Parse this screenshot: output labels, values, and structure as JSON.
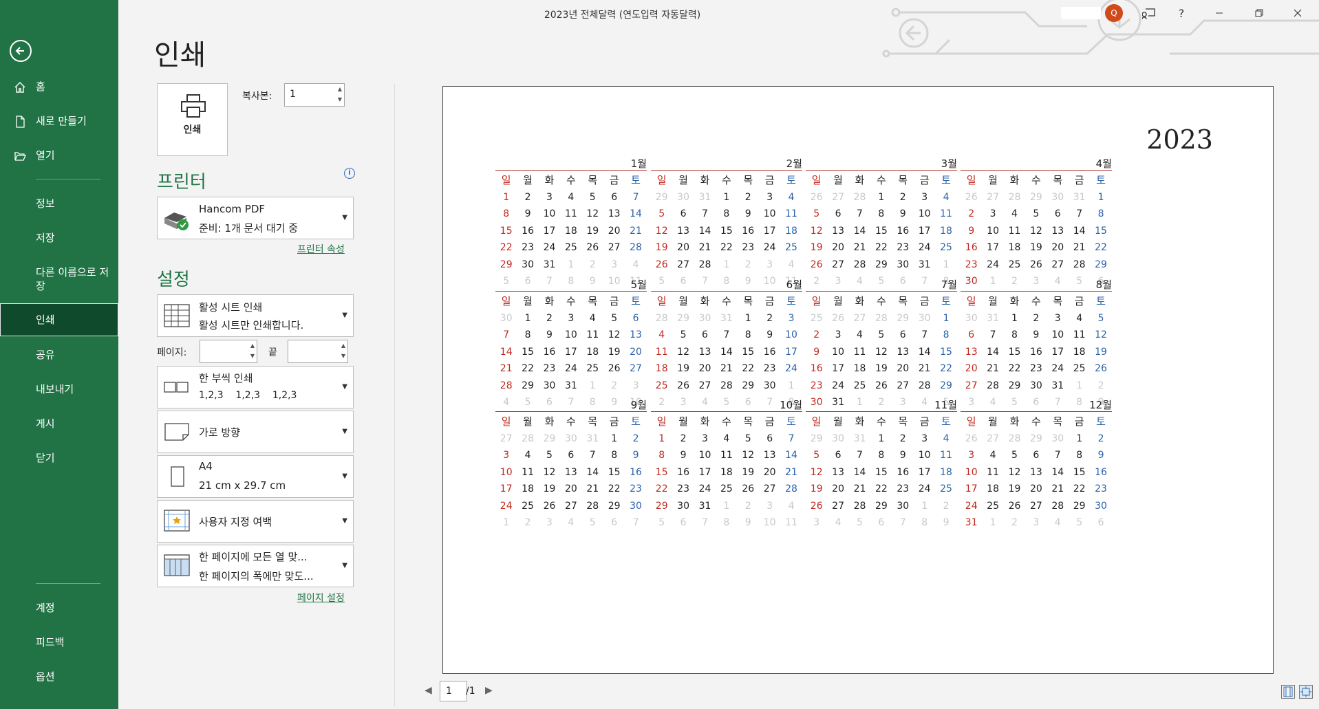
{
  "window": {
    "title": "2023년 전체달력 (연도입력 자동달력)",
    "avatar_initial": "Q",
    "help": "?"
  },
  "sidebar": {
    "items_top": [
      {
        "label": "홈"
      },
      {
        "label": "새로 만들기"
      },
      {
        "label": "열기"
      }
    ],
    "items_mid": [
      {
        "label": "정보"
      },
      {
        "label": "저장"
      },
      {
        "label": "다른 이름으로 저장"
      },
      {
        "label": "인쇄"
      },
      {
        "label": "공유"
      },
      {
        "label": "내보내기"
      },
      {
        "label": "게시"
      },
      {
        "label": "닫기"
      }
    ],
    "items_bottom": [
      {
        "label": "계정"
      },
      {
        "label": "피드백"
      },
      {
        "label": "옵션"
      }
    ],
    "active": "인쇄",
    "accent": "#217346"
  },
  "print": {
    "title": "인쇄",
    "button_label": "인쇄",
    "copies_label": "복사본:",
    "copies_value": "1",
    "printer_header": "프린터",
    "printer_name": "Hancom PDF",
    "printer_status": "준비: 1개 문서 대기 중",
    "printer_props_link": "프린터 속성",
    "settings_header": "설정",
    "scope_line1": "활성 시트 인쇄",
    "scope_line2": "활성 시트만 인쇄합니다.",
    "pages_label": "페이지:",
    "pages_to_label": "끝",
    "collate_line1": "한 부씩 인쇄",
    "collate_line2": "1,2,3    1,2,3    1,2,3",
    "orientation": "가로 방향",
    "paper_line1": "A4",
    "paper_line2": "21 cm x 29.7 cm",
    "margins": "사용자 지정 여백",
    "scaling_line1": "한 페이지에 모든 열 맞...",
    "scaling_line2": "한 페이지의 폭에만 맞도...",
    "page_setup_link": "페이지 설정"
  },
  "pager": {
    "current": "1",
    "total": "/1"
  },
  "calendar": {
    "year": "2023",
    "weekdays": [
      "일",
      "월",
      "화",
      "수",
      "목",
      "금",
      "토"
    ],
    "months": [
      {
        "name": "1월",
        "first": 0,
        "days": 31,
        "prev_days": 31
      },
      {
        "name": "2월",
        "first": 3,
        "days": 28,
        "prev_days": 31
      },
      {
        "name": "3월",
        "first": 3,
        "days": 31,
        "prev_days": 28
      },
      {
        "name": "4월",
        "first": 6,
        "days": 30,
        "prev_days": 31
      },
      {
        "name": "5월",
        "first": 1,
        "days": 31,
        "prev_days": 30
      },
      {
        "name": "6월",
        "first": 4,
        "days": 30,
        "prev_days": 31
      },
      {
        "name": "7월",
        "first": 6,
        "days": 31,
        "prev_days": 30
      },
      {
        "name": "8월",
        "first": 2,
        "days": 31,
        "prev_days": 31
      },
      {
        "name": "9월",
        "first": 5,
        "days": 30,
        "prev_days": 31
      },
      {
        "name": "10월",
        "first": 0,
        "days": 31,
        "prev_days": 30
      },
      {
        "name": "11월",
        "first": 3,
        "days": 30,
        "prev_days": 31
      },
      {
        "name": "12월",
        "first": 5,
        "days": 31,
        "prev_days": 30
      }
    ],
    "sunday_color": "#c0281e",
    "saturday_color": "#2a62a8"
  }
}
